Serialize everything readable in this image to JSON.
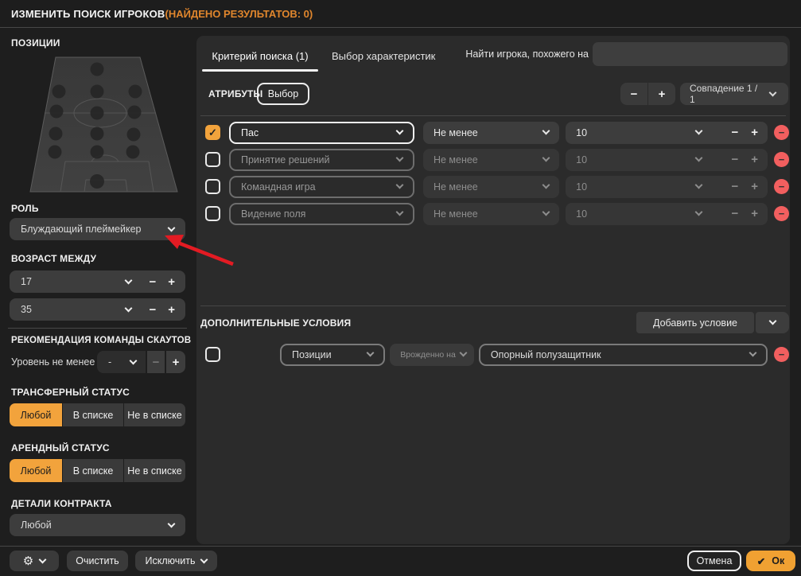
{
  "title": {
    "main": "ИЗМЕНИТЬ ПОИСК ИГРОКОВ",
    "results": "(НАЙДЕНО РЕЗУЛЬТАТОВ: 0)"
  },
  "colors": {
    "accent_orange": "#f2a33c",
    "result_orange": "#e0862d",
    "remove_red": "#f25f5f",
    "annotation_arrow_red": "#e31b23",
    "panel_bg": "#2b2b2b",
    "dialog_bg": "#1e1e1e"
  },
  "icons": {
    "minus": "−",
    "plus": "+",
    "check": "✓",
    "ok_check": "✔",
    "gear": "⚙",
    "remove": "−"
  },
  "sidebar": {
    "positions_label": "ПОЗИЦИИ",
    "role_label": "РОЛЬ",
    "role_value": "Блуждающий плеймейкер",
    "age_label": "ВОЗРАСТ МЕЖДУ",
    "age_min": "17",
    "age_max": "35",
    "scout_label": "РЕКОМЕНДАЦИЯ КОМАНДЫ СКАУТОВ",
    "scout_level_label": "Уровень не менее",
    "scout_level_value": "-",
    "transfer_label": "ТРАНСФЕРНЫЙ СТАТУС",
    "loan_label": "АРЕНДНЫЙ СТАТУС",
    "status_options": {
      "any": "Любой",
      "listed": "В списке",
      "not_listed": "Не в списке"
    },
    "contract_label": "ДЕТАЛИ КОНТРАКТА",
    "contract_value": "Любой"
  },
  "main": {
    "tabs": [
      {
        "label": "Критерий поиска (1)",
        "active": true
      },
      {
        "label": "Выбор характеристик",
        "active": false
      }
    ],
    "similar_label": "Найти игрока, похожего на",
    "similar_value": "",
    "attributes_label": "АТРИБУТЫ",
    "select_button": "Выбор",
    "match_dropdown": "Совпадение 1 / 1",
    "attribute_rows": [
      {
        "checked": true,
        "attribute": "Пас",
        "condition": "Не менее",
        "value": "10"
      },
      {
        "checked": false,
        "attribute": "Принятие решений",
        "condition": "Не менее",
        "value": "10"
      },
      {
        "checked": false,
        "attribute": "Командная игра",
        "condition": "Не менее",
        "value": "10"
      },
      {
        "checked": false,
        "attribute": "Видение поля",
        "condition": "Не менее",
        "value": "10"
      }
    ],
    "conditions_label": "ДОПОЛНИТЕЛЬНЫЕ УСЛОВИЯ",
    "add_condition_button": "Добавить условие",
    "condition_row": {
      "checked": false,
      "field": "Позиции",
      "operator": "Врожденно на",
      "value": "Опорный полузащитник"
    }
  },
  "footer": {
    "clear_button": "Очистить",
    "exclude_button": "Исключить",
    "cancel_button": "Отмена",
    "ok_button": "Ок"
  }
}
